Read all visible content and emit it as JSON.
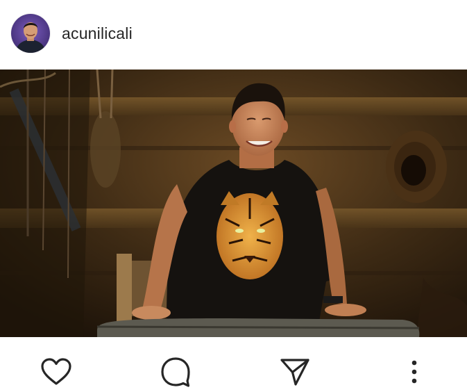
{
  "post": {
    "username": "acunilicali",
    "avatar_icon": "profile-photo",
    "image_icon": "post-photo"
  },
  "actions": {
    "like_icon": "heart-icon",
    "comment_icon": "comment-icon",
    "share_icon": "paper-plane-icon",
    "more_icon": "more-vertical-icon"
  },
  "colors": {
    "text": "#262626",
    "icon": "#262626",
    "background": "#ffffff"
  }
}
